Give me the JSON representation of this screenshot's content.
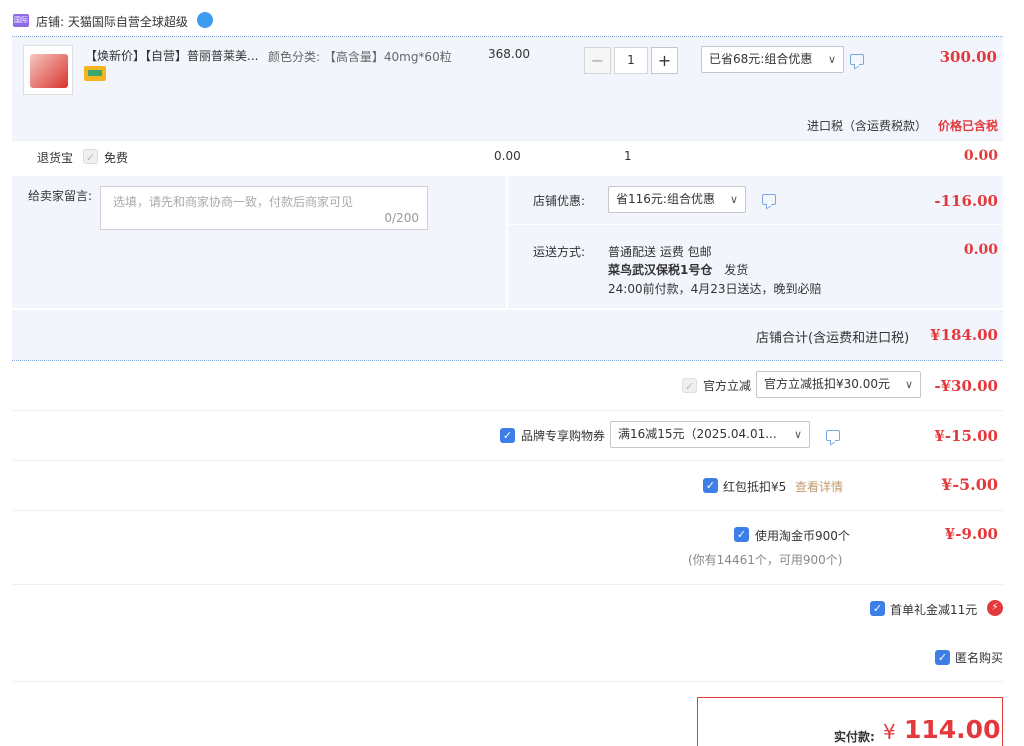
{
  "shop": {
    "prefix": "店铺:",
    "name": "天猫国际自营全球超级",
    "logo_text": "国际"
  },
  "product": {
    "title": "【焕新价】【自营】普丽普莱美...",
    "sku": "颜色分类: 【高含量】40mg*60粒",
    "price": "368.00",
    "qty": "1",
    "minus": "−",
    "plus": "+",
    "promo": "已省68元:组合优惠",
    "subtotal": "300.00"
  },
  "tax": {
    "label": "进口税（含运费税款）",
    "value": "价格已含税"
  },
  "return_insurance": {
    "label": "退货宝",
    "free": "免费",
    "price": "0.00",
    "qty": "1",
    "total": "0.00"
  },
  "message": {
    "label": "给卖家留言:",
    "placeholder": "选填，请先和商家协商一致，付款后商家可见",
    "counter": "0/200"
  },
  "shop_discount": {
    "label": "店铺优惠:",
    "selected": "省116元:组合优惠",
    "value": "-116.00"
  },
  "shipping": {
    "label": "运送方式:",
    "line1": "普通配送 运费 包邮",
    "line2_bold": "菜鸟武汉保税1号仓",
    "line2_rest": "发货",
    "line3": "24:00前付款，4月23日送达，晚到必赔",
    "value": "0.00"
  },
  "shop_total": {
    "label": "店铺合计(含运费和进口税)",
    "value": "¥184.00"
  },
  "official_discount": {
    "label": "官方立减",
    "selected": "官方立减抵扣¥30.00元",
    "value": "-¥30.00"
  },
  "brand_coupon": {
    "label": "品牌专享购物券",
    "selected": "满16减15元（2025.04.01...",
    "value": "¥-15.00"
  },
  "red_packet": {
    "label": "红包抵扣¥5",
    "link": "查看详情",
    "value": "¥-5.00"
  },
  "taojinbi": {
    "label": "使用淘金币900个",
    "note": "(你有14461个，可用900个)",
    "value": "¥-9.00"
  },
  "first_gift": {
    "label": "首单礼金减11元"
  },
  "anonymous": {
    "label": "匿名购买"
  },
  "payment": {
    "label": "实付款:",
    "currency": "¥",
    "amount": "114.00"
  },
  "chevron": "∨",
  "check": "✓",
  "colors": {
    "accent_red": "#e4393c",
    "check_blue": "#3d7fe6",
    "panel_blue": "#f2f6fc"
  }
}
